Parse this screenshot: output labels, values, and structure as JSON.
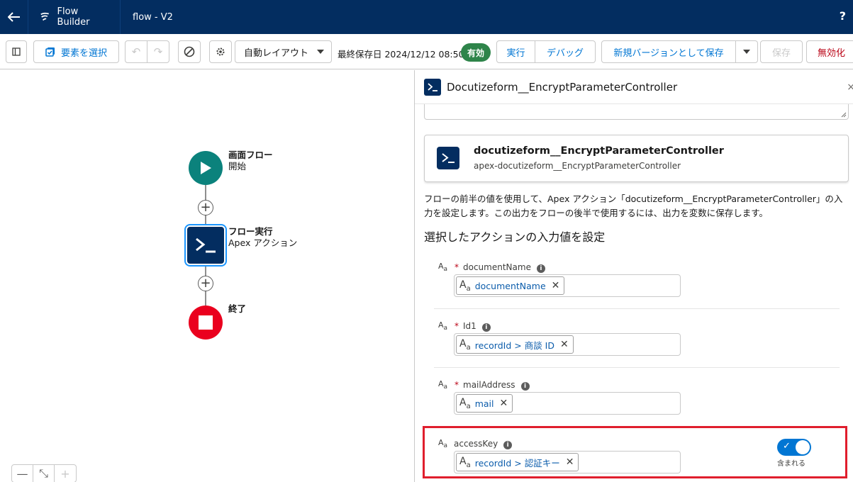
{
  "header": {
    "app_name": "Flow Builder",
    "flow_name": "flow - V2",
    "help": "?"
  },
  "toolbar": {
    "select_elements": "要素を選択",
    "layout": "自動レイアウト",
    "last_saved": "最終保存日 2024/12/12 08:50",
    "status_badge": "有効",
    "run": "実行",
    "debug": "デバッグ",
    "save_as_new_version": "新規バージョンとして保存",
    "save": "保存",
    "deactivate": "無効化"
  },
  "canvas": {
    "start_node": {
      "title": "画面フロー",
      "subtitle": "開始"
    },
    "action_node": {
      "title": "フロー実行",
      "subtitle": "Apex アクション"
    },
    "end_node": {
      "title": "終了"
    },
    "zoom_out": "—",
    "zoom_fit": "⤡",
    "zoom_in": "+"
  },
  "panel": {
    "title": "Docutizeform__EncryptParameterController",
    "close": "×",
    "action_card": {
      "title": "docutizeform__EncryptParameterController",
      "subtitle": "apex-docutizeform__EncryptParameterController"
    },
    "description": "フローの前半の値を使用して、Apex アクション「docutizeform__EncryptParameterController」の入力を設定します。この出力をフローの後半で使用するには、出力を変数に保存します。",
    "section_title": "選択したアクションの入力値を設定",
    "fields": [
      {
        "name": "documentName",
        "required": "*",
        "value": "documentName"
      },
      {
        "name": "Id1",
        "required": "*",
        "value": "recordId > 商談 ID"
      },
      {
        "name": "mailAddress",
        "required": "*",
        "value": "mail"
      },
      {
        "name": "accessKey",
        "required": "",
        "value": "recordId > 認証キー"
      }
    ],
    "include_toggle_label": "含まれる"
  },
  "colors": {
    "header_bg": "#032d60",
    "brand_blue": "#0176d3",
    "start_green": "#0b827c",
    "end_red": "#ea001e",
    "active_badge": "#2e844a",
    "highlight_red": "#e01e2d"
  }
}
